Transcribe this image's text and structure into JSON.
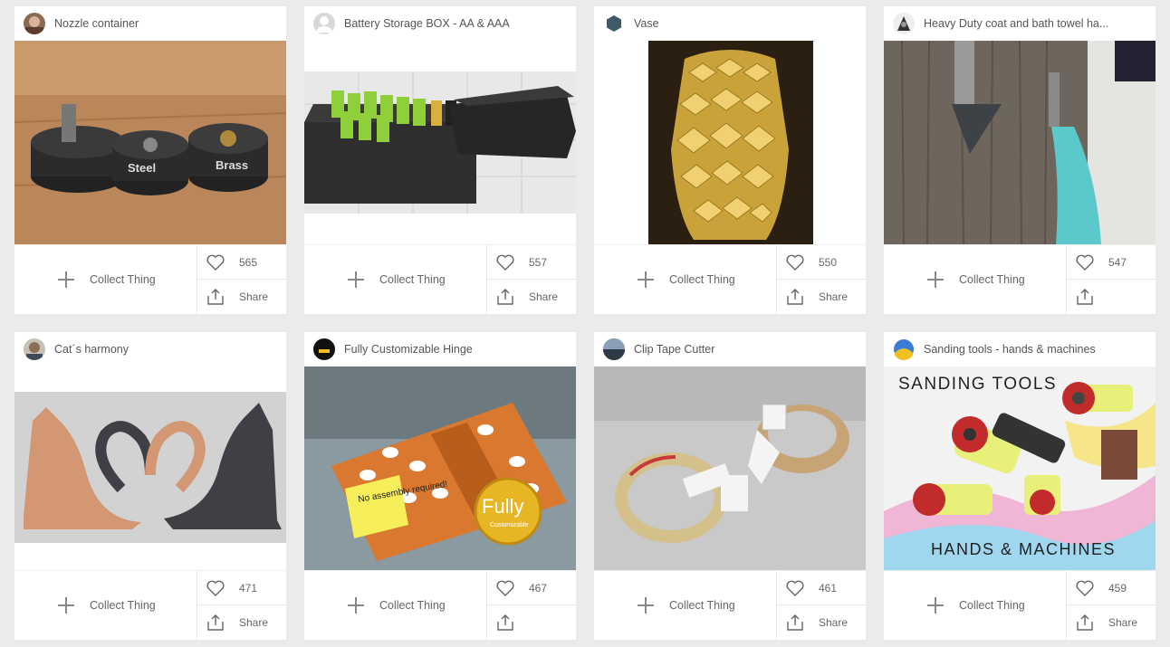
{
  "collect_label": "Collect Thing",
  "share_label": "Share",
  "cards": [
    {
      "title": "Nozzle container",
      "likes": "565",
      "share": "Share"
    },
    {
      "title": "Battery Storage BOX - AA & AAA",
      "likes": "557",
      "share": "Share"
    },
    {
      "title": "Vase",
      "likes": "550",
      "share": "Share"
    },
    {
      "title": "Heavy Duty coat and bath towel ha...",
      "likes": "547",
      "share": ""
    },
    {
      "title": "Cat´s harmony",
      "likes": "471",
      "share": "Share"
    },
    {
      "title": "Fully Customizable Hinge",
      "likes": "467",
      "share": ""
    },
    {
      "title": "Clip Tape Cutter",
      "likes": "461",
      "share": "Share"
    },
    {
      "title": "Sanding tools - hands & machines",
      "likes": "459",
      "share": "Share"
    }
  ],
  "image_text": {
    "nozzle_left": "Steel",
    "nozzle_right": "Brass",
    "hinge_note": "No assembly required!",
    "hinge_seal": "Fully",
    "hinge_seal_sub": "Customizable",
    "sanding_top": "SANDING TOOLS",
    "sanding_bottom": "HANDS & MACHINES"
  }
}
